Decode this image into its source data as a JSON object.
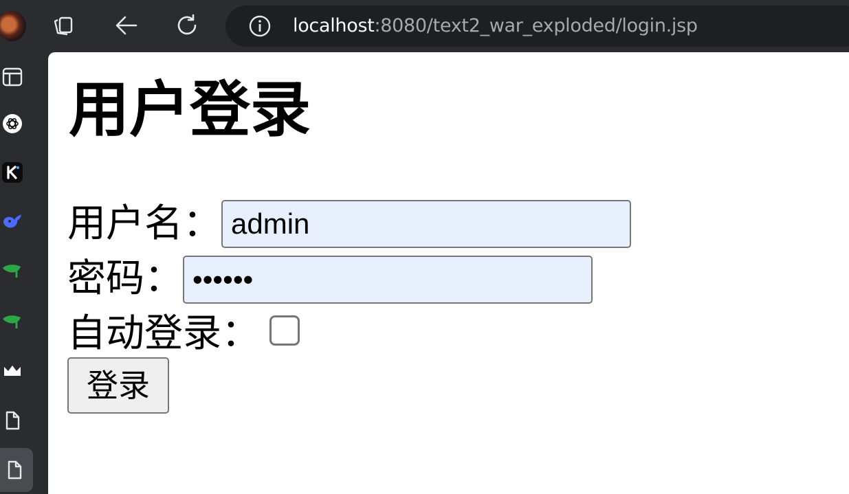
{
  "browser": {
    "url_host": "localhost",
    "url_rest": ":8080/text2_war_exploded/login.jsp"
  },
  "sidebar_icons": [
    "tab-icon",
    "chatgpt-icon",
    "k-app-icon",
    "whale-icon",
    "leaf-icon",
    "leaf-icon",
    "crown-icon",
    "document-icon",
    "document-icon"
  ],
  "page": {
    "title": "用户登录",
    "username_label": "用户名：",
    "username_value": "admin",
    "password_label": "密码：",
    "password_value": "••••••",
    "auto_login_label": "自动登录：",
    "auto_login_checked": false,
    "submit_label": "登录"
  }
}
